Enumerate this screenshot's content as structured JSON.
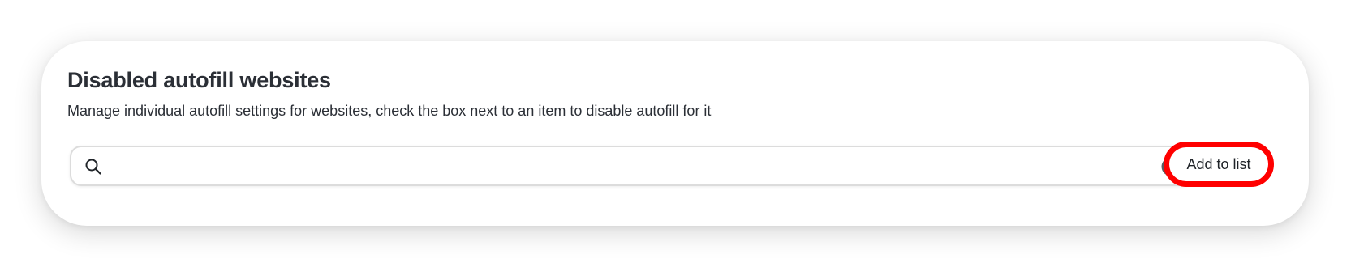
{
  "section": {
    "title": "Disabled autofill websites",
    "description": "Manage individual autofill settings for websites, check the box next to an item to disable autofill for it"
  },
  "search": {
    "value": "",
    "placeholder": "",
    "icon": "search-icon",
    "clear_icon": "clear-icon"
  },
  "add_button": {
    "label": "Add to list",
    "highlight_color": "#ff0000"
  },
  "colors": {
    "text": "#2b2f36",
    "border": "#dcdcdc",
    "clear_icon_fill": "#5a5d62"
  }
}
